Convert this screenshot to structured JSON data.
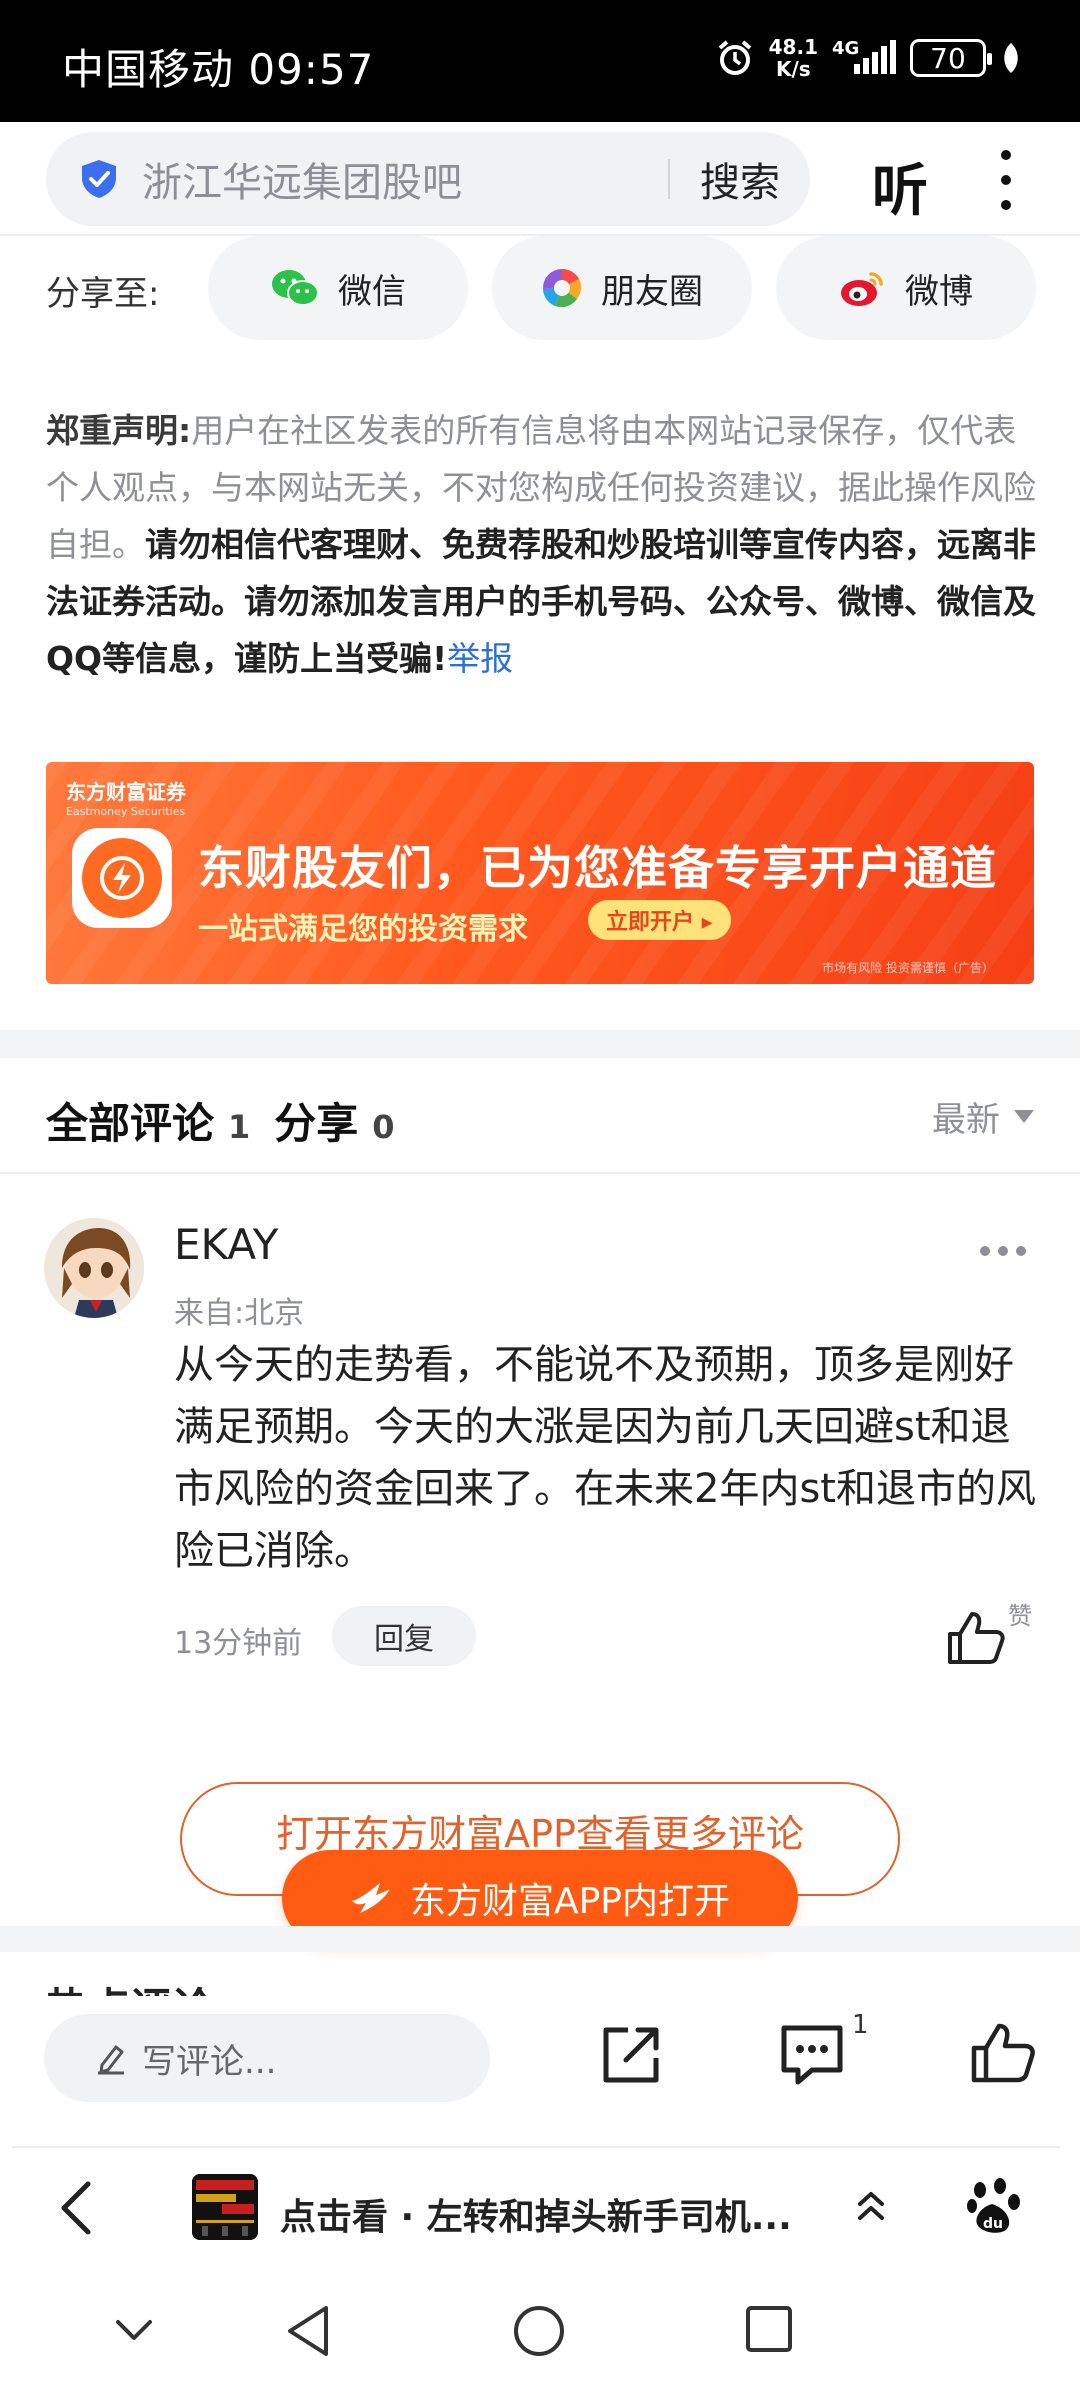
{
  "status_bar": {
    "carrier_time": "中国移动 09:57",
    "net_speed_top": "48.1",
    "net_speed_unit": "K/s",
    "network": "4G",
    "battery": "70"
  },
  "search_bar": {
    "query": "浙江华远集团股吧",
    "search_label": "搜索",
    "listen_label": "听"
  },
  "share": {
    "label": "分享至:",
    "targets": [
      "微信",
      "朋友圈",
      "微博"
    ]
  },
  "disclaimer": {
    "heading": "郑重声明:",
    "text_normal": "用户在社区发表的所有信息将由本网站记录保存，仅代表个人观点，与本网站无关，不对您构成任何投资建议，据此操作风险自担。",
    "text_bold": "请勿相信代客理财、免费荐股和炒股培训等宣传内容，远离非法证券活动。请勿添加发言用户的手机号码、公众号、微博、微信及QQ等信息，谨防上当受骗!",
    "report_link": "举报"
  },
  "ad": {
    "brand": "东方财富证券",
    "brand_en": "Eastmoney Securities",
    "title": "东财股友们，已为您准备专享开户通道",
    "subtitle": "一站式满足您的投资需求",
    "cta": "立即开户 ▸",
    "note": "市场有风险 投资需谨慎（广告）"
  },
  "comments_header": {
    "all_label": "全部评论",
    "all_count": "1",
    "share_label": "分享",
    "share_count": "0",
    "sort_label": "最新"
  },
  "comment": {
    "author": "EKAY",
    "location": "来自:北京",
    "body": "从今天的走势看，不能说不及预期，顶多是刚好满足预期。今天的大涨是因为前几天回避st和退市风险的资金回来了。在未来2年内st和退市的风险已消除。",
    "time": "13分钟前",
    "reply_label": "回复",
    "like_label": "赞"
  },
  "open_app": {
    "more_comments": "打开东方财富APP查看更多评论",
    "open_in_app": "东方财富APP内打开"
  },
  "cutoff_heading": "热点评论",
  "comment_toolbar": {
    "placeholder": "写评论...",
    "comment_badge": "1"
  },
  "browser_bar": {
    "page_title": "点击看 · 左转和掉头新手司机..."
  },
  "colors": {
    "accent_orange": "#ff5b12",
    "link_blue": "#2f6fd4",
    "muted_text": "#8e9096"
  }
}
